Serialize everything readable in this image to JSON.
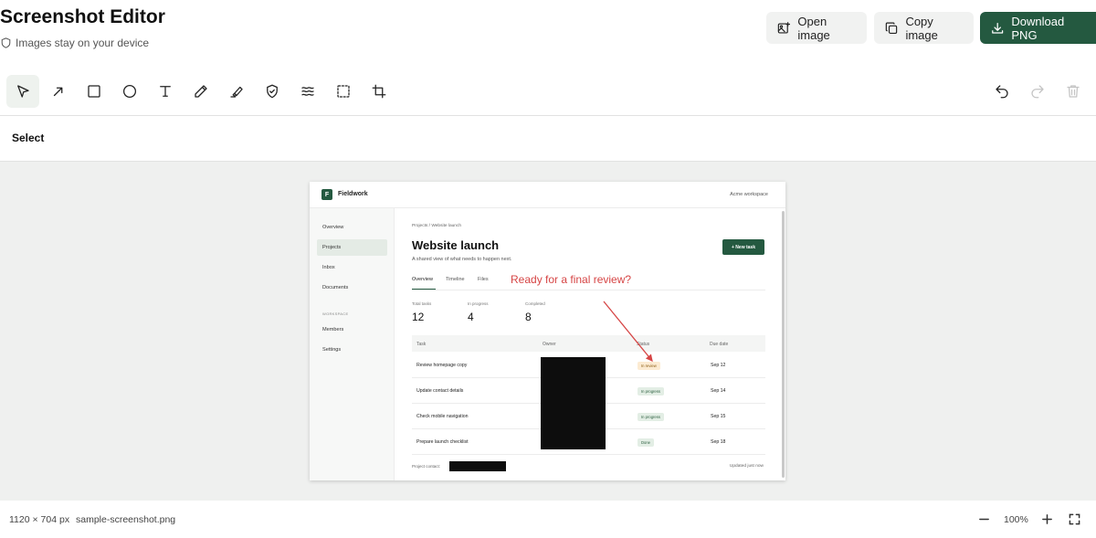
{
  "header": {
    "title": "Screenshot Editor",
    "subtitle": "Images stay on your device",
    "subtitle_icon": "shield-icon",
    "open_label": "Open image",
    "copy_label": "Copy image",
    "download_label": "Download PNG",
    "accent_color": "#245940"
  },
  "toolbar": {
    "tools": [
      {
        "name": "select",
        "icon": "cursor-icon",
        "active": true
      },
      {
        "name": "arrow",
        "icon": "arrow-icon"
      },
      {
        "name": "rectangle",
        "icon": "rectangle-icon"
      },
      {
        "name": "ellipse",
        "icon": "ellipse-icon"
      },
      {
        "name": "text",
        "icon": "text-icon"
      },
      {
        "name": "pen",
        "icon": "pen-icon"
      },
      {
        "name": "highlighter",
        "icon": "highlighter-icon"
      },
      {
        "name": "redact",
        "icon": "shield-icon"
      },
      {
        "name": "blur",
        "icon": "blur-icon"
      },
      {
        "name": "selection",
        "icon": "dashed-rect-icon"
      },
      {
        "name": "crop",
        "icon": "crop-icon"
      }
    ],
    "history": [
      {
        "name": "undo",
        "icon": "undo-icon",
        "enabled": true
      },
      {
        "name": "redo",
        "icon": "redo-icon",
        "enabled": false
      },
      {
        "name": "delete",
        "icon": "trash-icon",
        "enabled": false
      }
    ]
  },
  "mode_label": "Select",
  "screenshot": {
    "logo_letter": "F",
    "brand": "Fieldwork",
    "workspace": "Acme workspace",
    "nav": [
      "Overview",
      "Projects",
      "Inbox",
      "Documents"
    ],
    "nav_active": "Projects",
    "section_label": "WORKSPACE",
    "nav_workspace": [
      "Members",
      "Settings"
    ],
    "breadcrumb": "Projects / Website launch",
    "page_title": "Website launch",
    "page_subtitle": "A shared view of what needs to happen next.",
    "new_task": "+ New task",
    "tabs": [
      "Overview",
      "Timeline",
      "Files"
    ],
    "annotation": "Ready for a final review?",
    "annotation_color": "#d64545",
    "stats": [
      {
        "label": "Total tasks",
        "value": "12"
      },
      {
        "label": "In progress",
        "value": "4"
      },
      {
        "label": "Completed",
        "value": "8"
      }
    ],
    "columns": [
      "Task",
      "Owner",
      "Status",
      "Due date"
    ],
    "rows": [
      {
        "task": "Review homepage copy",
        "status": "In review",
        "due": "Sep 12"
      },
      {
        "task": "Update contact details",
        "status": "In progress",
        "due": "Sep 14"
      },
      {
        "task": "Check mobile navigation",
        "status": "In progress",
        "due": "Sep 15"
      },
      {
        "task": "Prepare launch checklist",
        "status": "Done",
        "due": "Sep 18"
      }
    ],
    "footer_left": "Project contact:",
    "footer_right": "Updated just now"
  },
  "statusbar": {
    "dimensions": "1120 × 704 px",
    "filename": "sample-screenshot.png",
    "zoom": "100%"
  }
}
